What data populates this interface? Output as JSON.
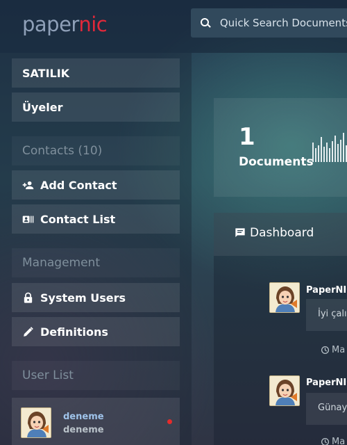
{
  "brand": {
    "logo_part1": "paper",
    "logo_part2": "nic"
  },
  "search": {
    "placeholder": "Quick Search Documents"
  },
  "sidebar": {
    "items": [
      {
        "label": "SATILIK"
      },
      {
        "label": "Üyeler"
      }
    ],
    "contacts_header": "Contacts (10)",
    "add_contact": "Add Contact",
    "contact_list": "Contact List",
    "management_header": "Management",
    "system_users": "System Users",
    "definitions": "Definitions",
    "user_list_header": "User List",
    "users": [
      {
        "name": "deneme",
        "subtitle": "deneme",
        "status": "offline"
      }
    ]
  },
  "stats": {
    "count": "1",
    "label": "Documents"
  },
  "dashboard": {
    "title": "Dashboard",
    "messages": [
      {
        "author": "PaperNIC",
        "text": "İyi çalışmalar",
        "time": "Ma"
      },
      {
        "author": "PaperNIC",
        "text": "Günaydın",
        "time": "Ma"
      }
    ]
  },
  "colors": {
    "accent_red": "#e0283a",
    "logo_grey": "#8fa0b8",
    "status_dot": "#e52b2b"
  }
}
